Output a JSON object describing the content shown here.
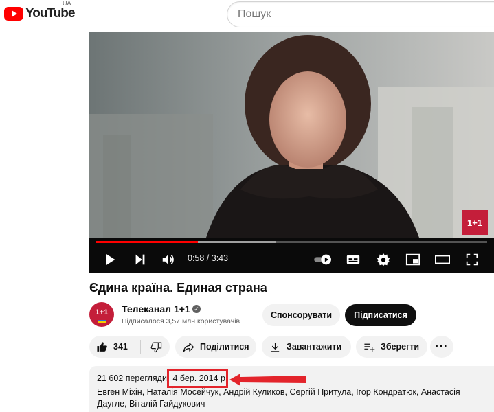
{
  "header": {
    "logo_text": "YouTube",
    "region": "UA",
    "search_placeholder": "Пошук"
  },
  "player": {
    "time_display": "0:58 / 3:43",
    "progress_fraction": 0.26,
    "buffer_fraction": 0.46,
    "channel_watermark": "1+1",
    "icons": [
      "play-icon",
      "next-icon",
      "volume-icon",
      "autoplay-toggle-icon",
      "subtitles-icon",
      "settings-icon",
      "miniplayer-icon",
      "theater-icon",
      "fullscreen-icon"
    ]
  },
  "video": {
    "title": "Єдина країна. Единая страна"
  },
  "channel": {
    "avatar_text": "1+1",
    "name": "Телеканал 1+1",
    "subscribers": "Підписалося 3,57 млн користувачів",
    "sponsor_label": "Спонсорувати",
    "subscribe_label": "Підписатися"
  },
  "actions": {
    "like_count": "341",
    "share_label": "Поділитися",
    "download_label": "Завантажити",
    "save_label": "Зберегти",
    "more_label": "···"
  },
  "description": {
    "views": "21 602 перегляди",
    "date": "4 бер. 2014 р.",
    "cast": "Евген Міхін, Наталія Мосейчук, Андрій Куликов, Сергій Притула, Ігор Кондратюк, Анастасія Даугле, Віталій Гайдукович"
  },
  "colors": {
    "brand_red": "#ff0000",
    "annotation_red": "#e3242b",
    "channel_red": "#c41e3a",
    "subscribe_bg": "#0f0f0f",
    "pill_bg": "#f2f2f2"
  }
}
